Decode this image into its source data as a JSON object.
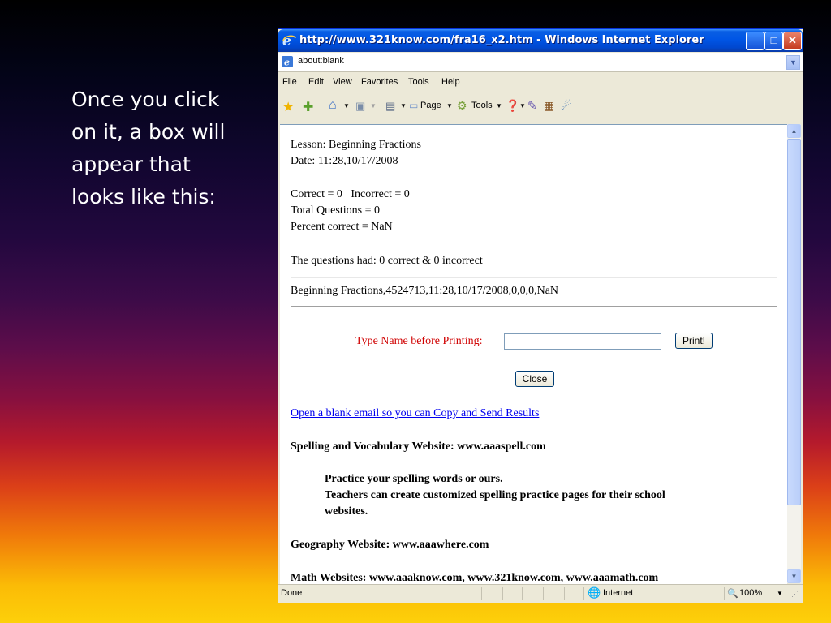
{
  "slide": {
    "caption": "Once you click\non it, a box will\nappear that\nlooks like this:"
  },
  "window": {
    "title": "http://www.321know.com/fra16_x2.htm - Windows Internet Explorer",
    "address": "about:blank",
    "menu": [
      "File",
      "Edit",
      "View",
      "Favorites",
      "Tools",
      "Help"
    ],
    "toolbar": {
      "page_label": "Page",
      "tools_label": "Tools"
    }
  },
  "content": {
    "lesson": "Lesson: Beginning Fractions",
    "date": "Date: 11:28,10/17/2008",
    "correct_incorrect": "Correct = 0   Incorrect = 0",
    "total": "Total Questions = 0",
    "percent": "Percent correct = NaN",
    "questions_had": "The questions had: 0 correct & 0 incorrect",
    "record": "Beginning Fractions,4524713,11:28,10/17/2008,0,0,0,NaN",
    "name_label": "Type Name before Printing:",
    "name_value": "",
    "print_button": "Print!",
    "close_button": "Close",
    "email_link": "Open a blank email so you can Copy and Send Results",
    "spelling_heading": "Spelling and Vocabulary Website: www.aaaspell.com",
    "spelling_line1": "Practice your spelling words or ours.",
    "spelling_line2": "Teachers can create customized spelling practice pages for their school",
    "spelling_line3": "websites.",
    "geo_heading": "Geography Website: www.aaawhere.com",
    "math_heading": "Math Websites: www.aaaknow.com, www.321know.com, www.aaamath.com"
  },
  "status": {
    "text": "Done",
    "zone": "Internet",
    "zoom": "100%"
  }
}
